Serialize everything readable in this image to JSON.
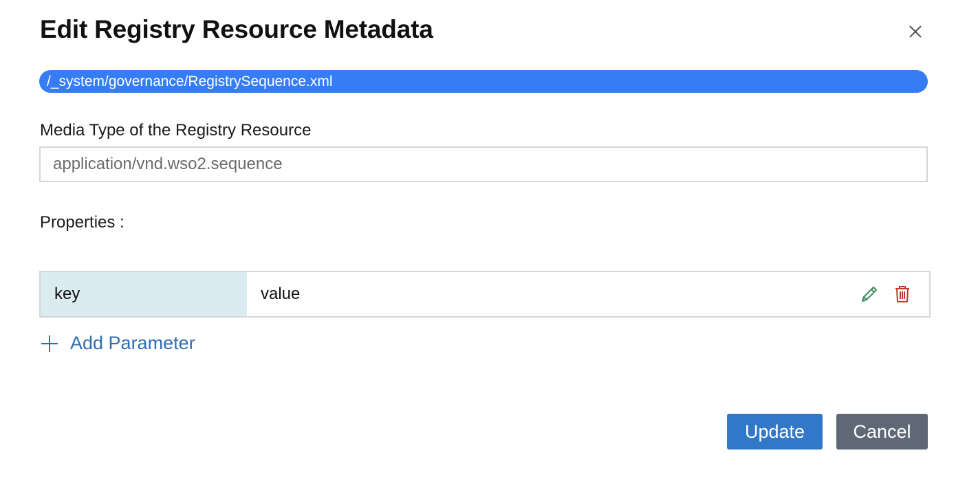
{
  "dialog": {
    "title": "Edit Registry Resource Metadata",
    "close_icon": "close-icon"
  },
  "resource": {
    "path": "/_system/governance/RegistrySequence.xml"
  },
  "media_type": {
    "label": "Media Type of the Registry Resource",
    "value": "application/vnd.wso2.sequence"
  },
  "properties": {
    "label": "Properties :",
    "rows": [
      {
        "key": "key",
        "value": "value"
      }
    ],
    "edit_icon": "pencil-icon",
    "delete_icon": "trash-icon",
    "add_label": "Add Parameter",
    "add_icon": "plus-icon"
  },
  "actions": {
    "update_label": "Update",
    "cancel_label": "Cancel"
  },
  "colors": {
    "primary": "#3278c8",
    "secondary": "#5f6976",
    "path_pill": "#367df5",
    "key_cell": "#dbebf2",
    "edit_icon": "#3a8c5c",
    "delete_icon": "#c0392b",
    "link": "#2f6db3"
  }
}
